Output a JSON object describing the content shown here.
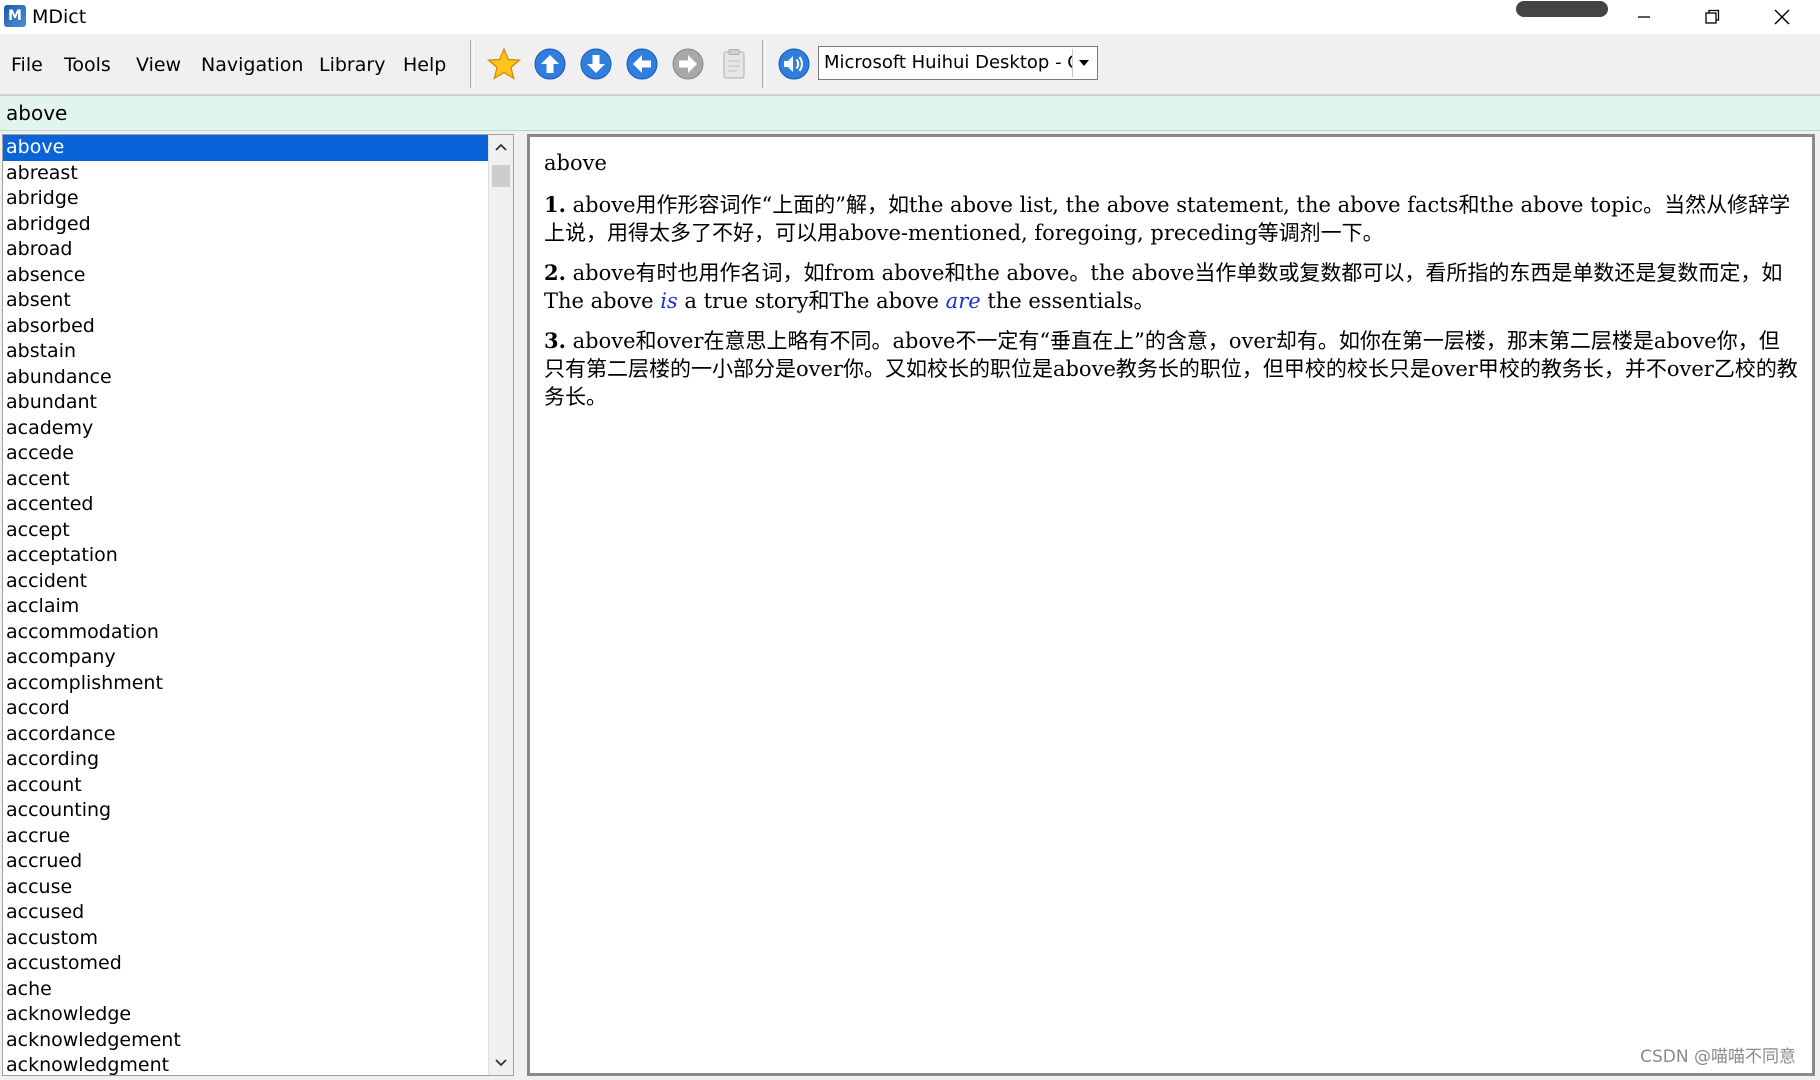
{
  "window": {
    "title": "MDict",
    "app_icon_letter": "M"
  },
  "menu": {
    "file": "File",
    "tools": "Tools",
    "view": "View",
    "navigation": "Navigation",
    "library": "Library",
    "help": "Help"
  },
  "toolbar": {
    "voice_selected": "Microsoft Huihui Desktop - C"
  },
  "search": {
    "value": "above"
  },
  "wordlist": {
    "items": [
      "above",
      "abreast",
      "abridge",
      "abridged",
      "abroad",
      "absence",
      "absent",
      "absorbed",
      "abstain",
      "abundance",
      "abundant",
      "academy",
      "accede",
      "accent",
      "accented",
      "accept",
      "acceptation",
      "accident",
      "acclaim",
      "accommodation",
      "accompany",
      "accomplishment",
      "accord",
      "accordance",
      "according",
      "account",
      "accounting",
      "accrue",
      "accrued",
      "accuse",
      "accused",
      "accustom",
      "accustomed",
      "ache",
      "acknowledge",
      "acknowledgement",
      "acknowledgment"
    ]
  },
  "definition": {
    "headword": "above",
    "p1": {
      "num": "1.",
      "text": "above用作形容词作“上面的”解，如the above list, the above statement, the above facts和the above topic。当然从修辞学上说，用得太多了不好，可以用above-mentioned, foregoing, preceding等调剂一下。"
    },
    "p2": {
      "num": "2.",
      "text_a": "above有时也用作名词，如from above和the above。the above当作单数或复数都可以，看所指的东西是单数还是复数而定，如The above ",
      "ital_a": "is",
      "text_b": " a true story和The above ",
      "ital_b": "are",
      "text_c": " the essentials。"
    },
    "p3": {
      "num": "3.",
      "text": "above和over在意思上略有不同。above不一定有“垂直在上”的含意，over却有。如你在第一层楼，那末第二层楼是above你，但只有第二层楼的一小部分是over你。又如校长的职位是above教务长的职位，但甲校的校长只是over甲校的教务长，并不over乙校的教务长。"
    }
  },
  "watermark": "CSDN @喵喵不同意",
  "colors": {
    "selection": "#0a63d8",
    "search_bg": "#e2f4ef",
    "italic_link": "#1a2fd6"
  }
}
